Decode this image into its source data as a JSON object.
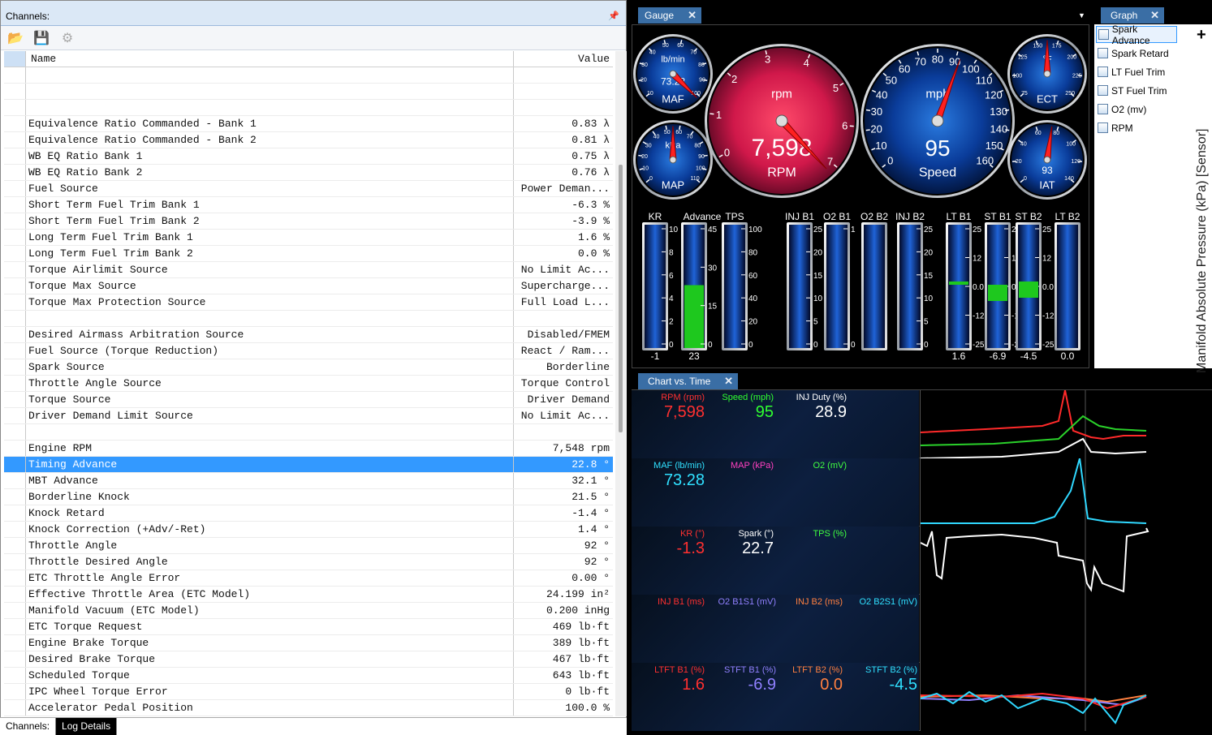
{
  "channels": {
    "title": "Channels:",
    "pin": "⌕",
    "columns": {
      "name": "Name",
      "value": "Value"
    },
    "rows": [
      {
        "name": "",
        "value": ""
      },
      {
        "name": "",
        "value": ""
      },
      {
        "name": "",
        "value": ""
      },
      {
        "name": "Equivalence Ratio Commanded - Bank 1",
        "value": "0.83 λ"
      },
      {
        "name": "Equivalence Ratio Commanded - Bank 2",
        "value": "0.81 λ"
      },
      {
        "name": "WB EQ Ratio Bank 1",
        "value": "0.75 λ"
      },
      {
        "name": "WB EQ Ratio Bank 2",
        "value": "0.76 λ"
      },
      {
        "name": "Fuel Source",
        "value": "Power Deman..."
      },
      {
        "name": "Short Term Fuel Trim Bank 1",
        "value": "-6.3 %"
      },
      {
        "name": "Short Term Fuel Trim Bank 2",
        "value": "-3.9 %"
      },
      {
        "name": "Long Term Fuel Trim Bank 1",
        "value": "1.6 %"
      },
      {
        "name": "Long Term Fuel Trim Bank 2",
        "value": "0.0 %"
      },
      {
        "name": "Torque Airlimit Source",
        "value": "No Limit Ac..."
      },
      {
        "name": "Torque Max Source",
        "value": "Supercharge..."
      },
      {
        "name": "Torque Max Protection Source",
        "value": "Full Load L..."
      },
      {
        "name": "",
        "value": ""
      },
      {
        "name": "Desired Airmass Arbitration Source",
        "value": "Disabled/FMEM"
      },
      {
        "name": "Fuel Source (Torque Reduction)",
        "value": "React / Ram..."
      },
      {
        "name": "Spark Source",
        "value": "Borderline"
      },
      {
        "name": "Throttle Angle Source",
        "value": "Torque Control"
      },
      {
        "name": "Torque Source",
        "value": "Driver Demand"
      },
      {
        "name": "Driver Demand Limit Source",
        "value": "No Limit Ac..."
      },
      {
        "name": "",
        "value": ""
      },
      {
        "name": "Engine RPM",
        "value": "7,548 rpm"
      },
      {
        "name": "Timing Advance",
        "value": "22.8 °",
        "selected": true
      },
      {
        "name": "MBT Advance",
        "value": "32.1 °"
      },
      {
        "name": "Borderline Knock",
        "value": "21.5 °"
      },
      {
        "name": "Knock Retard",
        "value": "-1.4 °"
      },
      {
        "name": "Knock Correction (+Adv/-Ret)",
        "value": "1.4 °"
      },
      {
        "name": "Throttle Angle",
        "value": "92 °"
      },
      {
        "name": "Throttle Desired Angle",
        "value": "92 °"
      },
      {
        "name": "ETC Throttle Angle Error",
        "value": "0.00 °"
      },
      {
        "name": "Effective Throttle Area (ETC Model)",
        "value": "24.199 in²"
      },
      {
        "name": "Manifold Vacuum (ETC Model)",
        "value": "0.200 inHg"
      },
      {
        "name": "ETC Torque Request",
        "value": "469 lb·ft"
      },
      {
        "name": "Engine Brake Torque",
        "value": "389 lb·ft"
      },
      {
        "name": "Desired Brake Torque",
        "value": "467 lb·ft"
      },
      {
        "name": "Scheduled Torque",
        "value": "643 lb·ft"
      },
      {
        "name": "IPC Wheel Torque Error",
        "value": "0 lb·ft"
      },
      {
        "name": "Accelerator Pedal Position",
        "value": "100.0 %"
      }
    ],
    "bottom_tabs": [
      "Channels:",
      "Log Details"
    ]
  },
  "tabs": {
    "gauge": "Gauge",
    "graph": "Graph",
    "chart": "Chart vs. Time"
  },
  "gauges": {
    "maf": {
      "unit": "lb/min",
      "value": "73.28",
      "label": "MAF",
      "ticks": [
        "10",
        "20",
        "30",
        "40",
        "50",
        "60",
        "70",
        "80",
        "90",
        "100"
      ]
    },
    "map": {
      "unit": "kPa",
      "label": "MAP",
      "ticks": [
        "0",
        "10",
        "20",
        "30",
        "40",
        "50",
        "60",
        "70",
        "80",
        "90",
        "100",
        "110"
      ]
    },
    "rpm": {
      "unit": "rpm",
      "value": "7,598",
      "label": "RPM",
      "ticks": [
        "0",
        "1",
        "2",
        "3",
        "4",
        "5",
        "6",
        "7"
      ]
    },
    "speed": {
      "unit": "mph",
      "value": "95",
      "label": "Speed",
      "ticks": [
        "0",
        "10",
        "20",
        "30",
        "40",
        "50",
        "60",
        "70",
        "80",
        "90",
        "100",
        "110",
        "120",
        "130",
        "140",
        "150",
        "160"
      ]
    },
    "ect": {
      "unit": "°F",
      "label": "ECT",
      "ticks": [
        "75",
        "100",
        "125",
        "150",
        "175",
        "200",
        "225",
        "250"
      ]
    },
    "iat": {
      "value": "93",
      "label": "IAT",
      "ticks": [
        "0",
        "20",
        "40",
        "60",
        "80",
        "100",
        "120",
        "140"
      ]
    }
  },
  "bars": [
    {
      "label": "KR",
      "value": "-1",
      "scale": [
        "10",
        "8",
        "6",
        "4",
        "2",
        "0"
      ],
      "level": 0
    },
    {
      "label": "Advance",
      "value": "23",
      "scale": [
        "45",
        "30",
        "15",
        "0"
      ],
      "level": 0.51
    },
    {
      "label": "TPS",
      "value": "",
      "scale": [
        "100",
        "80",
        "60",
        "40",
        "20",
        "0"
      ],
      "level": 0
    },
    {
      "label": "INJ B1",
      "value": "",
      "scale": [
        "25",
        "20",
        "15",
        "10",
        "5",
        "0"
      ],
      "level": 0
    },
    {
      "label": "O2 B1",
      "value": "",
      "scale": [
        "1",
        "0"
      ],
      "level": 0
    },
    {
      "label": "O2 B2",
      "value": "",
      "scale": [],
      "level": 0
    },
    {
      "label": "INJ B2",
      "value": "",
      "scale": [
        "25",
        "20",
        "15",
        "10",
        "5",
        "0"
      ],
      "level": 0
    },
    {
      "label": "LT B1",
      "value": "1.6",
      "scale": [
        "25",
        "12",
        "0.0",
        "-12",
        "-25"
      ],
      "level": 0
    },
    {
      "label": "ST B1",
      "value": "-6.9",
      "scale": [
        "25",
        "12",
        "0.0",
        "-12",
        "-25"
      ],
      "level": 0
    },
    {
      "label": "ST B2",
      "value": "-4.5",
      "scale": [
        "25",
        "12",
        "0.0",
        "-12",
        "-25"
      ],
      "level": 0
    },
    {
      "label": "LT B2",
      "value": "0.0",
      "scale": [],
      "level": 0
    }
  ],
  "graph": {
    "items": [
      "Spark Advance",
      "Spark Retard",
      "LT Fuel Trim",
      "ST Fuel Trim",
      "O2 (mv)",
      "RPM"
    ],
    "vertical_label": "Manifold Absolute Pressure (kPa) [Sensor]",
    "add": "+"
  },
  "chart_rows": [
    {
      "items": [
        {
          "label": "RPM (rpm)",
          "value": "7,598",
          "color": "#ff3030"
        },
        {
          "label": "Speed (mph)",
          "value": "95",
          "color": "#30ff30"
        },
        {
          "label": "INJ Duty (%)",
          "value": "28.9",
          "color": "#ffffff"
        }
      ]
    },
    {
      "items": [
        {
          "label": "MAF (lb/min)",
          "value": "73.28",
          "color": "#30e0ff"
        },
        {
          "label": "MAP (kPa)",
          "value": "",
          "color": "#ff40c0"
        },
        {
          "label": "O2 (mV)",
          "value": "",
          "color": "#40ff40"
        }
      ]
    },
    {
      "items": [
        {
          "label": "KR (°)",
          "value": "-1.3",
          "color": "#ff3030"
        },
        {
          "label": "Spark (°)",
          "value": "22.7",
          "color": "#ffffff"
        },
        {
          "label": "TPS (%)",
          "value": "",
          "color": "#40ff40"
        }
      ]
    },
    {
      "items": [
        {
          "label": "INJ B1 (ms)",
          "value": "",
          "color": "#ff3030"
        },
        {
          "label": "O2 B1S1 (mV)",
          "value": "",
          "color": "#9080ff"
        },
        {
          "label": "INJ B2 (ms)",
          "value": "",
          "color": "#ff8040"
        },
        {
          "label": "O2 B2S1 (mV)",
          "value": "",
          "color": "#30e0ff"
        }
      ]
    },
    {
      "items": [
        {
          "label": "LTFT B1 (%)",
          "value": "1.6",
          "color": "#ff3030"
        },
        {
          "label": "STFT B1 (%)",
          "value": "-6.9",
          "color": "#9080ff"
        },
        {
          "label": "LTFT B2 (%)",
          "value": "0.0",
          "color": "#ff8040"
        },
        {
          "label": "STFT B2 (%)",
          "value": "-4.5",
          "color": "#30e0ff"
        }
      ]
    }
  ]
}
